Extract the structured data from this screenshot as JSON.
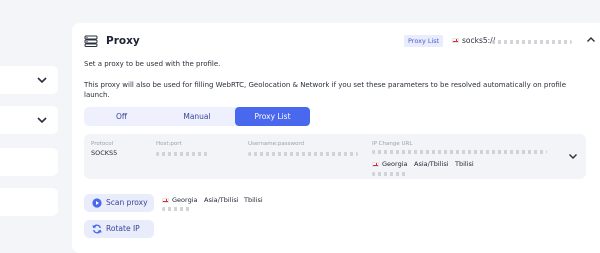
{
  "left_panel": {
    "icons": [
      "chevron-down-icon",
      "chevron-down-icon"
    ]
  },
  "section": {
    "title": "Proxy",
    "icon": "proxy-list-icon",
    "badge": "Proxy List",
    "header_proxy_prefix": "socks5://",
    "collapse_icon": "chevron-up-icon"
  },
  "description": {
    "line1": "Set a proxy to be used with the profile.",
    "line2": "This proxy will also be used for filling WebRTC, Geolocation & Network if you set these parameters to be resolved automatically on profile launch."
  },
  "tabs": [
    {
      "label": "Off",
      "active": false
    },
    {
      "label": "Manual",
      "active": false
    },
    {
      "label": "Proxy List",
      "active": true
    }
  ],
  "proxy_info": {
    "protocol_label": "Protocol",
    "protocol_value": "SOCKS5",
    "host_label": "Host:port",
    "username_label": "Username:password",
    "ip_change_label": "IP Change URL",
    "country": "Georgia",
    "timezone": "Asia/Tbilisi",
    "city": "Tbilisi"
  },
  "actions": {
    "scan_label": "Scan proxy",
    "rotate_label": "Rotate IP",
    "scan_country": "Georgia",
    "scan_timezone": "Asia/Tbilisi",
    "scan_city": "Tbilisi"
  },
  "colors": {
    "accent": "#4a68ee",
    "accent_light": "#e8ecfb",
    "text": "#1f2433",
    "muted": "#9aa0ad"
  }
}
